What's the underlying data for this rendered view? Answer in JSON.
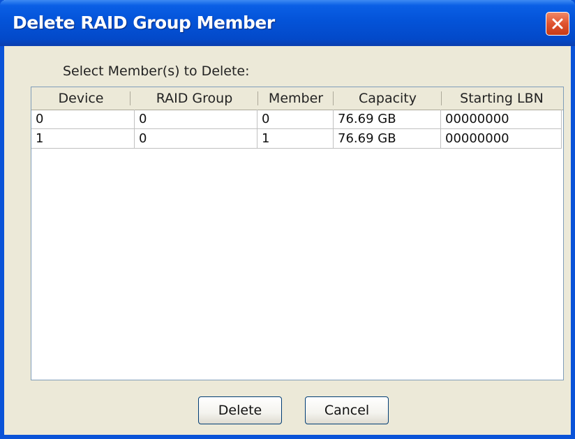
{
  "window": {
    "title": "Delete RAID Group Member"
  },
  "prompt": "Select Member(s) to Delete:",
  "table": {
    "headers": [
      "Device",
      "RAID Group",
      "Member",
      "Capacity",
      "Starting LBN"
    ],
    "rows": [
      [
        "0",
        "0",
        "0",
        "76.69 GB",
        "00000000"
      ],
      [
        "1",
        "0",
        "1",
        "76.69 GB",
        "00000000"
      ]
    ]
  },
  "buttons": {
    "delete_label": "Delete",
    "cancel_label": "Cancel"
  },
  "icons": {
    "close": "close-icon"
  },
  "colors": {
    "titlebar": "#0453d8",
    "close_button": "#e0532f",
    "dialog_bg": "#ece9d8"
  }
}
